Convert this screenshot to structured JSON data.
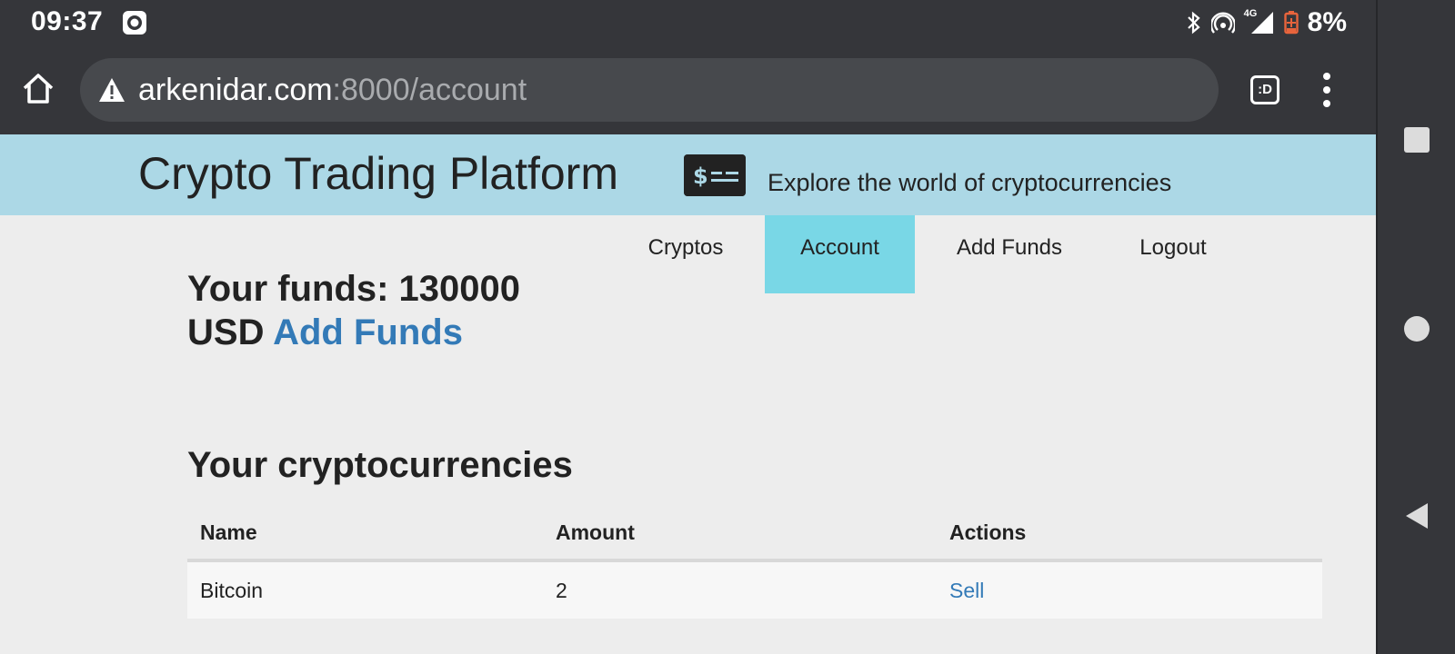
{
  "status_bar": {
    "time": "09:37",
    "battery_percent": "8%",
    "network_label": "4G",
    "icons": [
      "screen-record-icon",
      "bluetooth-icon",
      "hotspot-icon",
      "signal-icon",
      "battery-icon"
    ]
  },
  "browser": {
    "url_host": "arkenidar.com",
    "url_rest": ":8000/account",
    "tabs_button_label": ":D",
    "icons": [
      "home-icon",
      "warning-icon",
      "tabs-icon",
      "menu-icon"
    ]
  },
  "header": {
    "title": "Crypto Trading Platform",
    "tagline": "Explore the world of cryptocurrencies",
    "icon": "cash-icon"
  },
  "nav": {
    "items": [
      {
        "label": "Cryptos",
        "active": false
      },
      {
        "label": "Account",
        "active": true
      },
      {
        "label": "Add Funds",
        "active": false
      },
      {
        "label": "Logout",
        "active": false
      }
    ]
  },
  "account": {
    "funds_text": "Your funds: 130000 USD",
    "add_funds_link": "Add Funds",
    "cryptos_heading": "Your cryptocurrencies"
  },
  "table": {
    "columns": [
      "Name",
      "Amount",
      "Actions"
    ],
    "rows": [
      {
        "name": "Bitcoin",
        "amount": "2",
        "action": "Sell"
      }
    ]
  },
  "colors": {
    "header_band": "#acd8e6",
    "nav_active": "#79d7e6",
    "link": "#337ab7",
    "battery_low": "#e8643c"
  },
  "system_nav": {
    "icons": [
      "recents-icon",
      "home-circle-icon",
      "back-icon"
    ]
  }
}
